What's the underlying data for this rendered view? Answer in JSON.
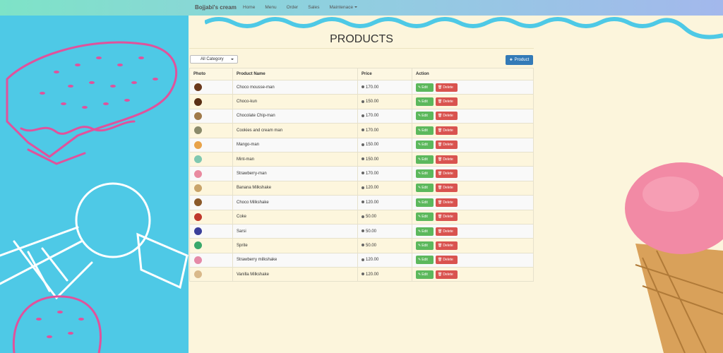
{
  "navbar": {
    "brand": "Bojjabi's cream",
    "links": [
      "Home",
      "Menu",
      "Order",
      "Sales",
      "Maintenace"
    ]
  },
  "page": {
    "title": "PRODUCTS"
  },
  "filter": {
    "category_value": "All Category"
  },
  "toolbar": {
    "add_label": "Product"
  },
  "table": {
    "headers": [
      "Photo",
      "Product Name",
      "Price",
      "Action"
    ],
    "rows": [
      {
        "name": "Choco mousse-man",
        "price": "170.00",
        "thumb_color": "#6b3a1e"
      },
      {
        "name": "Choco-kun",
        "price": "150.00",
        "thumb_color": "#5a2f14"
      },
      {
        "name": "Chocolate Chip-man",
        "price": "170.00",
        "thumb_color": "#a07a4a"
      },
      {
        "name": "Cookies and cream man",
        "price": "170.00",
        "thumb_color": "#8a8a6a"
      },
      {
        "name": "Mango-man",
        "price": "150.00",
        "thumb_color": "#e8a34a"
      },
      {
        "name": "Mint-man",
        "price": "150.00",
        "thumb_color": "#7fc8b0"
      },
      {
        "name": "Strawberry-man",
        "price": "170.00",
        "thumb_color": "#e98aa0"
      },
      {
        "name": "Banana Milkshake",
        "price": "120.00",
        "thumb_color": "#c9a46a"
      },
      {
        "name": "Choco Milkshake",
        "price": "120.00",
        "thumb_color": "#8b5a2b"
      },
      {
        "name": "Coke",
        "price": "50.00",
        "thumb_color": "#c0392b"
      },
      {
        "name": "Sarsi",
        "price": "50.00",
        "thumb_color": "#3a3f9a"
      },
      {
        "name": "Sprite",
        "price": "50.00",
        "thumb_color": "#3aa86b"
      },
      {
        "name": "Strawberry milkshake",
        "price": "120.00",
        "thumb_color": "#e58aa8"
      },
      {
        "name": "Vanilla Milkshake",
        "price": "120.00",
        "thumb_color": "#d9b98a"
      }
    ],
    "edit_label": "Edit",
    "delete_label": "Delete"
  },
  "colors": {
    "left_panel": "#4ec9e6",
    "page_bg": "#fcf5dc",
    "primary": "#337ab7",
    "edit": "#5cb85c",
    "delete": "#d9534f"
  },
  "icons": {
    "add": "plus-icon",
    "edit": "pencil-icon",
    "delete": "trash-icon",
    "price": "coin-icon"
  }
}
